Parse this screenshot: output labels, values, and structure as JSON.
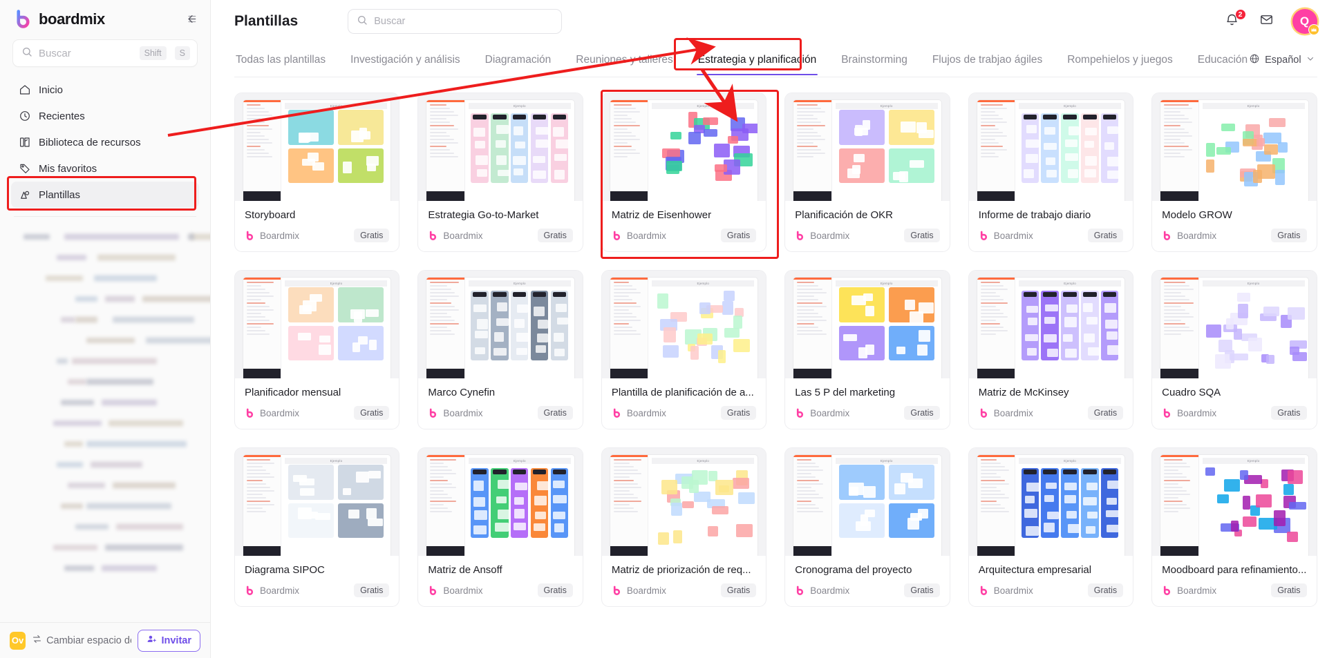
{
  "brand": {
    "name": "boardmix",
    "logo_icon": "boardmix-logo-icon"
  },
  "sidebar": {
    "collapse_icon": "collapse-panel-icon",
    "search": {
      "placeholder": "Buscar",
      "icon": "search-icon",
      "shortcut_modifier": "Shift",
      "shortcut_key": "S"
    },
    "items": [
      {
        "label": "Inicio",
        "icon": "home-icon"
      },
      {
        "label": "Recientes",
        "icon": "clock-icon"
      },
      {
        "label": "Biblioteca de recursos",
        "icon": "library-icon"
      },
      {
        "label": "Mis favoritos",
        "icon": "tag-icon"
      },
      {
        "label": "Plantillas",
        "icon": "templates-icon"
      }
    ],
    "active_item": "Plantillas",
    "bottom": {
      "workspace_badge": "Ov",
      "switch_label": "Cambiar espacio de tr",
      "switch_icon": "swap-icon",
      "invite_label": "Invitar",
      "invite_icon": "add-user-icon"
    }
  },
  "header": {
    "title": "Plantillas",
    "search": {
      "placeholder": "Buscar",
      "icon": "search-icon"
    },
    "notifications": {
      "icon": "bell-icon",
      "badge": "2"
    },
    "inbox": {
      "icon": "inbox-icon"
    },
    "avatar": {
      "initial": "Q",
      "crown_icon": "crown-icon"
    }
  },
  "tabs": {
    "items": [
      "Todas las plantillas",
      "Investigación y análisis",
      "Diagramación",
      "Reuniones y talleres",
      "Estrategia y planificación",
      "Brainstorming",
      "Flujos de trabjao ágiles",
      "Rompehielos y juegos",
      "Educación"
    ],
    "active": "Estrategia y planificación",
    "language": {
      "label": "Español",
      "icon": "globe-icon",
      "chevron": "chevron-down-icon"
    }
  },
  "templates": {
    "author": "Boardmix",
    "price_label": "Gratis",
    "example_label": "Ejemplo",
    "cards": [
      {
        "title": "Storyboard",
        "author": "Boardmix",
        "price": "Gratis",
        "highlighted": false
      },
      {
        "title": "Estrategia Go-to-Market",
        "author": "Boardmix",
        "price": "Gratis",
        "highlighted": false
      },
      {
        "title": "Matriz de Eisenhower",
        "author": "Boardmix",
        "price": "Gratis",
        "highlighted": true
      },
      {
        "title": "Planificación de OKR",
        "author": "Boardmix",
        "price": "Gratis",
        "highlighted": false
      },
      {
        "title": "Informe de trabajo diario",
        "author": "Boardmix",
        "price": "Gratis",
        "highlighted": false
      },
      {
        "title": "Modelo GROW",
        "author": "Boardmix",
        "price": "Gratis",
        "highlighted": false
      },
      {
        "title": "Planificador mensual",
        "author": "Boardmix",
        "price": "Gratis",
        "highlighted": false
      },
      {
        "title": "Marco Cynefin",
        "author": "Boardmix",
        "price": "Gratis",
        "highlighted": false
      },
      {
        "title": "Plantilla de planificación de a...",
        "author": "Boardmix",
        "price": "Gratis",
        "highlighted": false
      },
      {
        "title": "Las 5 P del marketing",
        "author": "Boardmix",
        "price": "Gratis",
        "highlighted": false
      },
      {
        "title": "Matriz de McKinsey",
        "author": "Boardmix",
        "price": "Gratis",
        "highlighted": false
      },
      {
        "title": "Cuadro SQA",
        "author": "Boardmix",
        "price": "Gratis",
        "highlighted": false
      },
      {
        "title": "Diagrama SIPOC",
        "author": "Boardmix",
        "price": "Gratis",
        "highlighted": false
      },
      {
        "title": "Matriz de Ansoff",
        "author": "Boardmix",
        "price": "Gratis",
        "highlighted": false
      },
      {
        "title": "Matriz de priorización de req...",
        "author": "Boardmix",
        "price": "Gratis",
        "highlighted": false
      },
      {
        "title": "Cronograma del proyecto",
        "author": "Boardmix",
        "price": "Gratis",
        "highlighted": false
      },
      {
        "title": "Arquitectura empresarial",
        "author": "Boardmix",
        "price": "Gratis",
        "highlighted": false
      },
      {
        "title": "Moodboard para refinamiento...",
        "author": "Boardmix",
        "price": "Gratis",
        "highlighted": false
      }
    ]
  },
  "annotations": {
    "highlight_color": "#ee1d1d",
    "boxes": [
      "sidebar-plantillas",
      "tab-estrategia-y-planificacion",
      "card-matriz-de-eisenhower"
    ],
    "arrows": [
      "long-arrow-to-tab",
      "short-arrow-to-card"
    ]
  }
}
